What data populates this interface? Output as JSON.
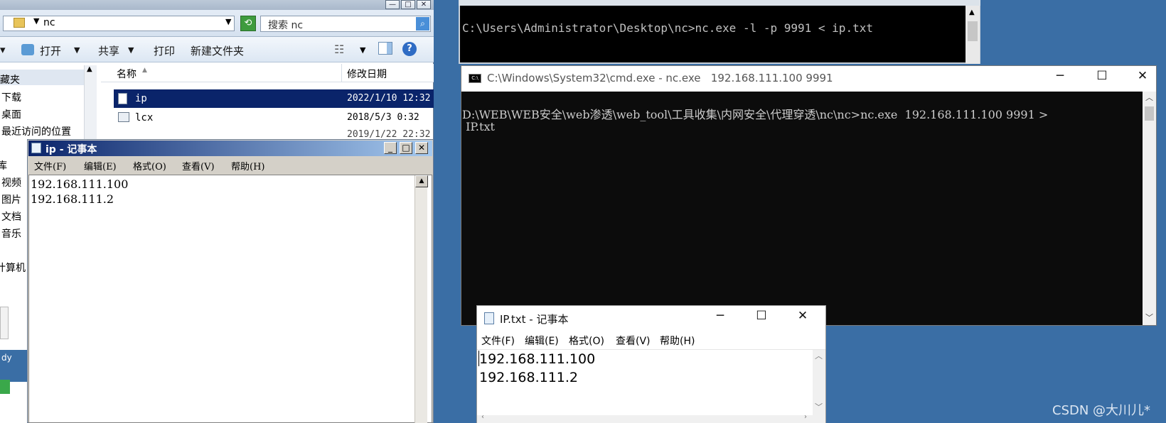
{
  "explorer": {
    "address": "nc",
    "search_placeholder": "搜索 nc",
    "toolbar": {
      "open": "打开",
      "share": "共享",
      "print": "打印",
      "new_folder": "新建文件夹"
    },
    "nav_items": [
      "收藏夹",
      "下载",
      "桌面",
      "最近访问的位置",
      "库",
      "视频",
      "图片",
      "文档",
      "音乐",
      "计算机"
    ],
    "nav_visible": [
      "藏夹",
      "下载",
      "桌面",
      "最近访问的位置",
      "库",
      "视频",
      "图片",
      "文档",
      "音乐",
      "计算机"
    ],
    "columns": {
      "name": "名称",
      "date": "修改日期"
    },
    "files": [
      {
        "name": "ip",
        "date": "2022/1/10 12:32",
        "selected": true
      },
      {
        "name": "lcx",
        "date": "2018/5/3 0:32",
        "selected": false
      },
      {
        "name": "",
        "date": "2019/1/22 22:32",
        "selected": false
      }
    ],
    "status_fragment": "dy"
  },
  "notepad_classic": {
    "title": "ip - 记事本",
    "menu": [
      "文件(F)",
      "编辑(E)",
      "格式(O)",
      "查看(V)",
      "帮助(H)"
    ],
    "lines": [
      "192.168.111.100",
      "192.168.111.2"
    ]
  },
  "cmd_listener": {
    "command": "C:\\Users\\Administrator\\Desktop\\nc>nc.exe -l -p 9991 < ip.txt"
  },
  "cmd_client": {
    "title": "C:\\Windows\\System32\\cmd.exe - nc.exe   192.168.111.100 9991",
    "line1": "D:\\WEB\\WEB安全\\web渗透\\web_tool\\工具收集\\内网安全\\代理穿透\\nc\\nc>nc.exe  192.168.111.100 9991 >",
    "line2": " IP.txt"
  },
  "notepad_win10": {
    "title": "IP.txt - 记事本",
    "menu": [
      "文件(F)",
      "编辑(E)",
      "格式(O)",
      "查看(V)",
      "帮助(H)"
    ],
    "lines": [
      "192.168.111.100",
      "192.168.111.2"
    ]
  },
  "watermark": "CSDN @大川儿*",
  "colors": {
    "desktop": "#3a6ea5",
    "selection": "#0a246a",
    "console_bg": "#0c0c0c",
    "console_text": "#cccccc"
  }
}
